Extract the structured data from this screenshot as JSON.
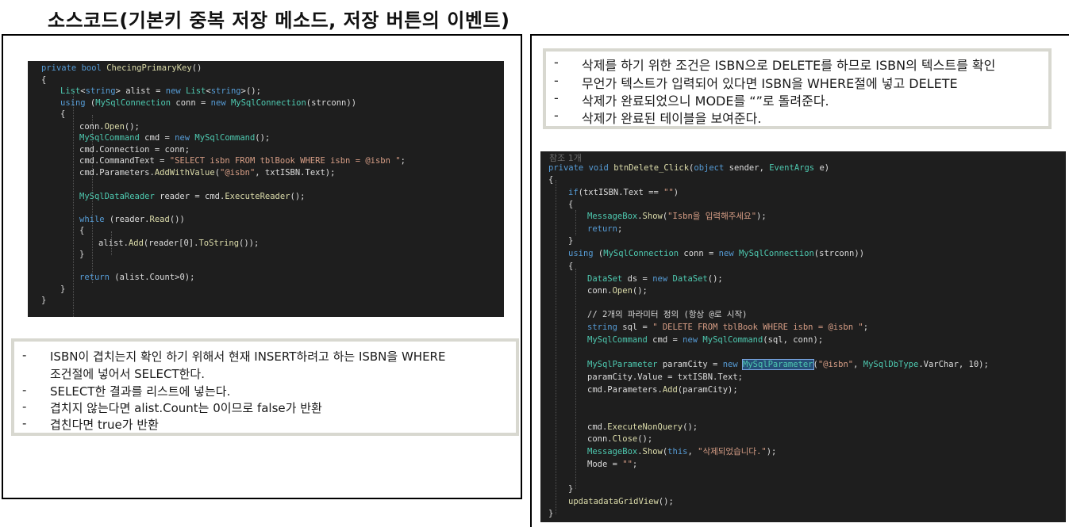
{
  "page_title": "소스코드(기본키 중복 저장 메소드, 저장 버튼의 이벤트)",
  "left_code": {
    "lines": [
      "private bool ChecingPrimaryKey()",
      "{",
      "    List<string> alist = new List<string>();",
      "    using (MySqlConnection conn = new MySqlConnection(strconn))",
      "    {",
      "        conn.Open();",
      "        MySqlCommand cmd = new MySqlCommand();",
      "        cmd.Connection = conn;",
      "        cmd.CommandText = \"SELECT isbn FROM tblBook WHERE isbn = @isbn \";",
      "        cmd.Parameters.AddWithValue(\"@isbn\", txtISBN.Text);",
      "",
      "        MySqlDataReader reader = cmd.ExecuteReader();",
      "",
      "        while (reader.Read())",
      "        {",
      "            alist.Add(reader[0].ToString());",
      "        }",
      "",
      "        return (alist.Count>0);",
      "    }",
      "}"
    ]
  },
  "left_notes": {
    "items": [
      "ISBN이 겹치는지 확인 하기 위해서 현재 INSERT하려고 하는 ISBN을 WHERE",
      "조건절에 넣어서 SELECT한다.",
      "SELECT한 결과를 리스트에 넣는다.",
      "겹치지 않는다면 alist.Count는 0이므로 false가 반환",
      "겹친다면 true가 반환"
    ]
  },
  "right_notes": {
    "items": [
      "삭제를 하기 위한 조건은 ISBN으로 DELETE를 하므로 ISBN의 텍스트를 확인",
      "무언가 텍스트가 입력되어 있다면 ISBN을 WHERE절에  넣고 DELETE",
      "삭제가 완료되었으니 MODE를 “”로 돌려준다.",
      "삭제가 완료된 테이블을 보여준다."
    ]
  },
  "right_code": {
    "reference_count": "참조 1개",
    "lines": [
      "private void btnDelete_Click(object sender, EventArgs e)",
      "{",
      "    if(txtISBN.Text == \"\")",
      "    {",
      "        MessageBox.Show(\"Isbn을 입력해주세요\");",
      "        return;",
      "    }",
      "    using (MySqlConnection conn = new MySqlConnection(strconn))",
      "    {",
      "        DataSet ds = new DataSet();",
      "        conn.Open();",
      "",
      "        // 2개의 파라미터 정의 (항상 @로 시작)",
      "        string sql = \" DELETE FROM tblBook WHERE isbn = @isbn \";",
      "        MySqlCommand cmd = new MySqlCommand(sql, conn);",
      "",
      "        MySqlParameter paramCity = new MySqlParameter(\"@isbn\", MySqlDbType.VarChar, 10);",
      "        paramCity.Value = txtISBN.Text;",
      "        cmd.Parameters.Add(paramCity);",
      "",
      "",
      "        cmd.ExecuteNonQuery();",
      "        conn.Close();",
      "        MessageBox.Show(this, \"삭제되었습니다.\");",
      "        Mode = \"\";",
      "",
      "    }",
      "    updatadataGridView();",
      "}"
    ]
  }
}
